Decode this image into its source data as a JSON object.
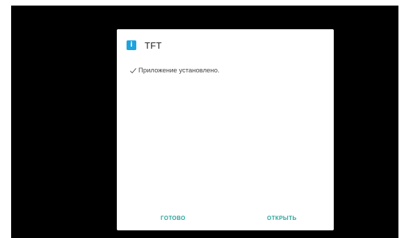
{
  "dialog": {
    "title": "TFT",
    "icon": "info-icon",
    "status_text": "Приложение установлено.",
    "status_icon": "checkmark-icon"
  },
  "actions": {
    "done_label": "ГОТОВО",
    "open_label": "ОТКРЫТЬ"
  },
  "colors": {
    "accent": "#26a69a",
    "icon_bg": "#1fa3dc",
    "backdrop": "#000000"
  }
}
